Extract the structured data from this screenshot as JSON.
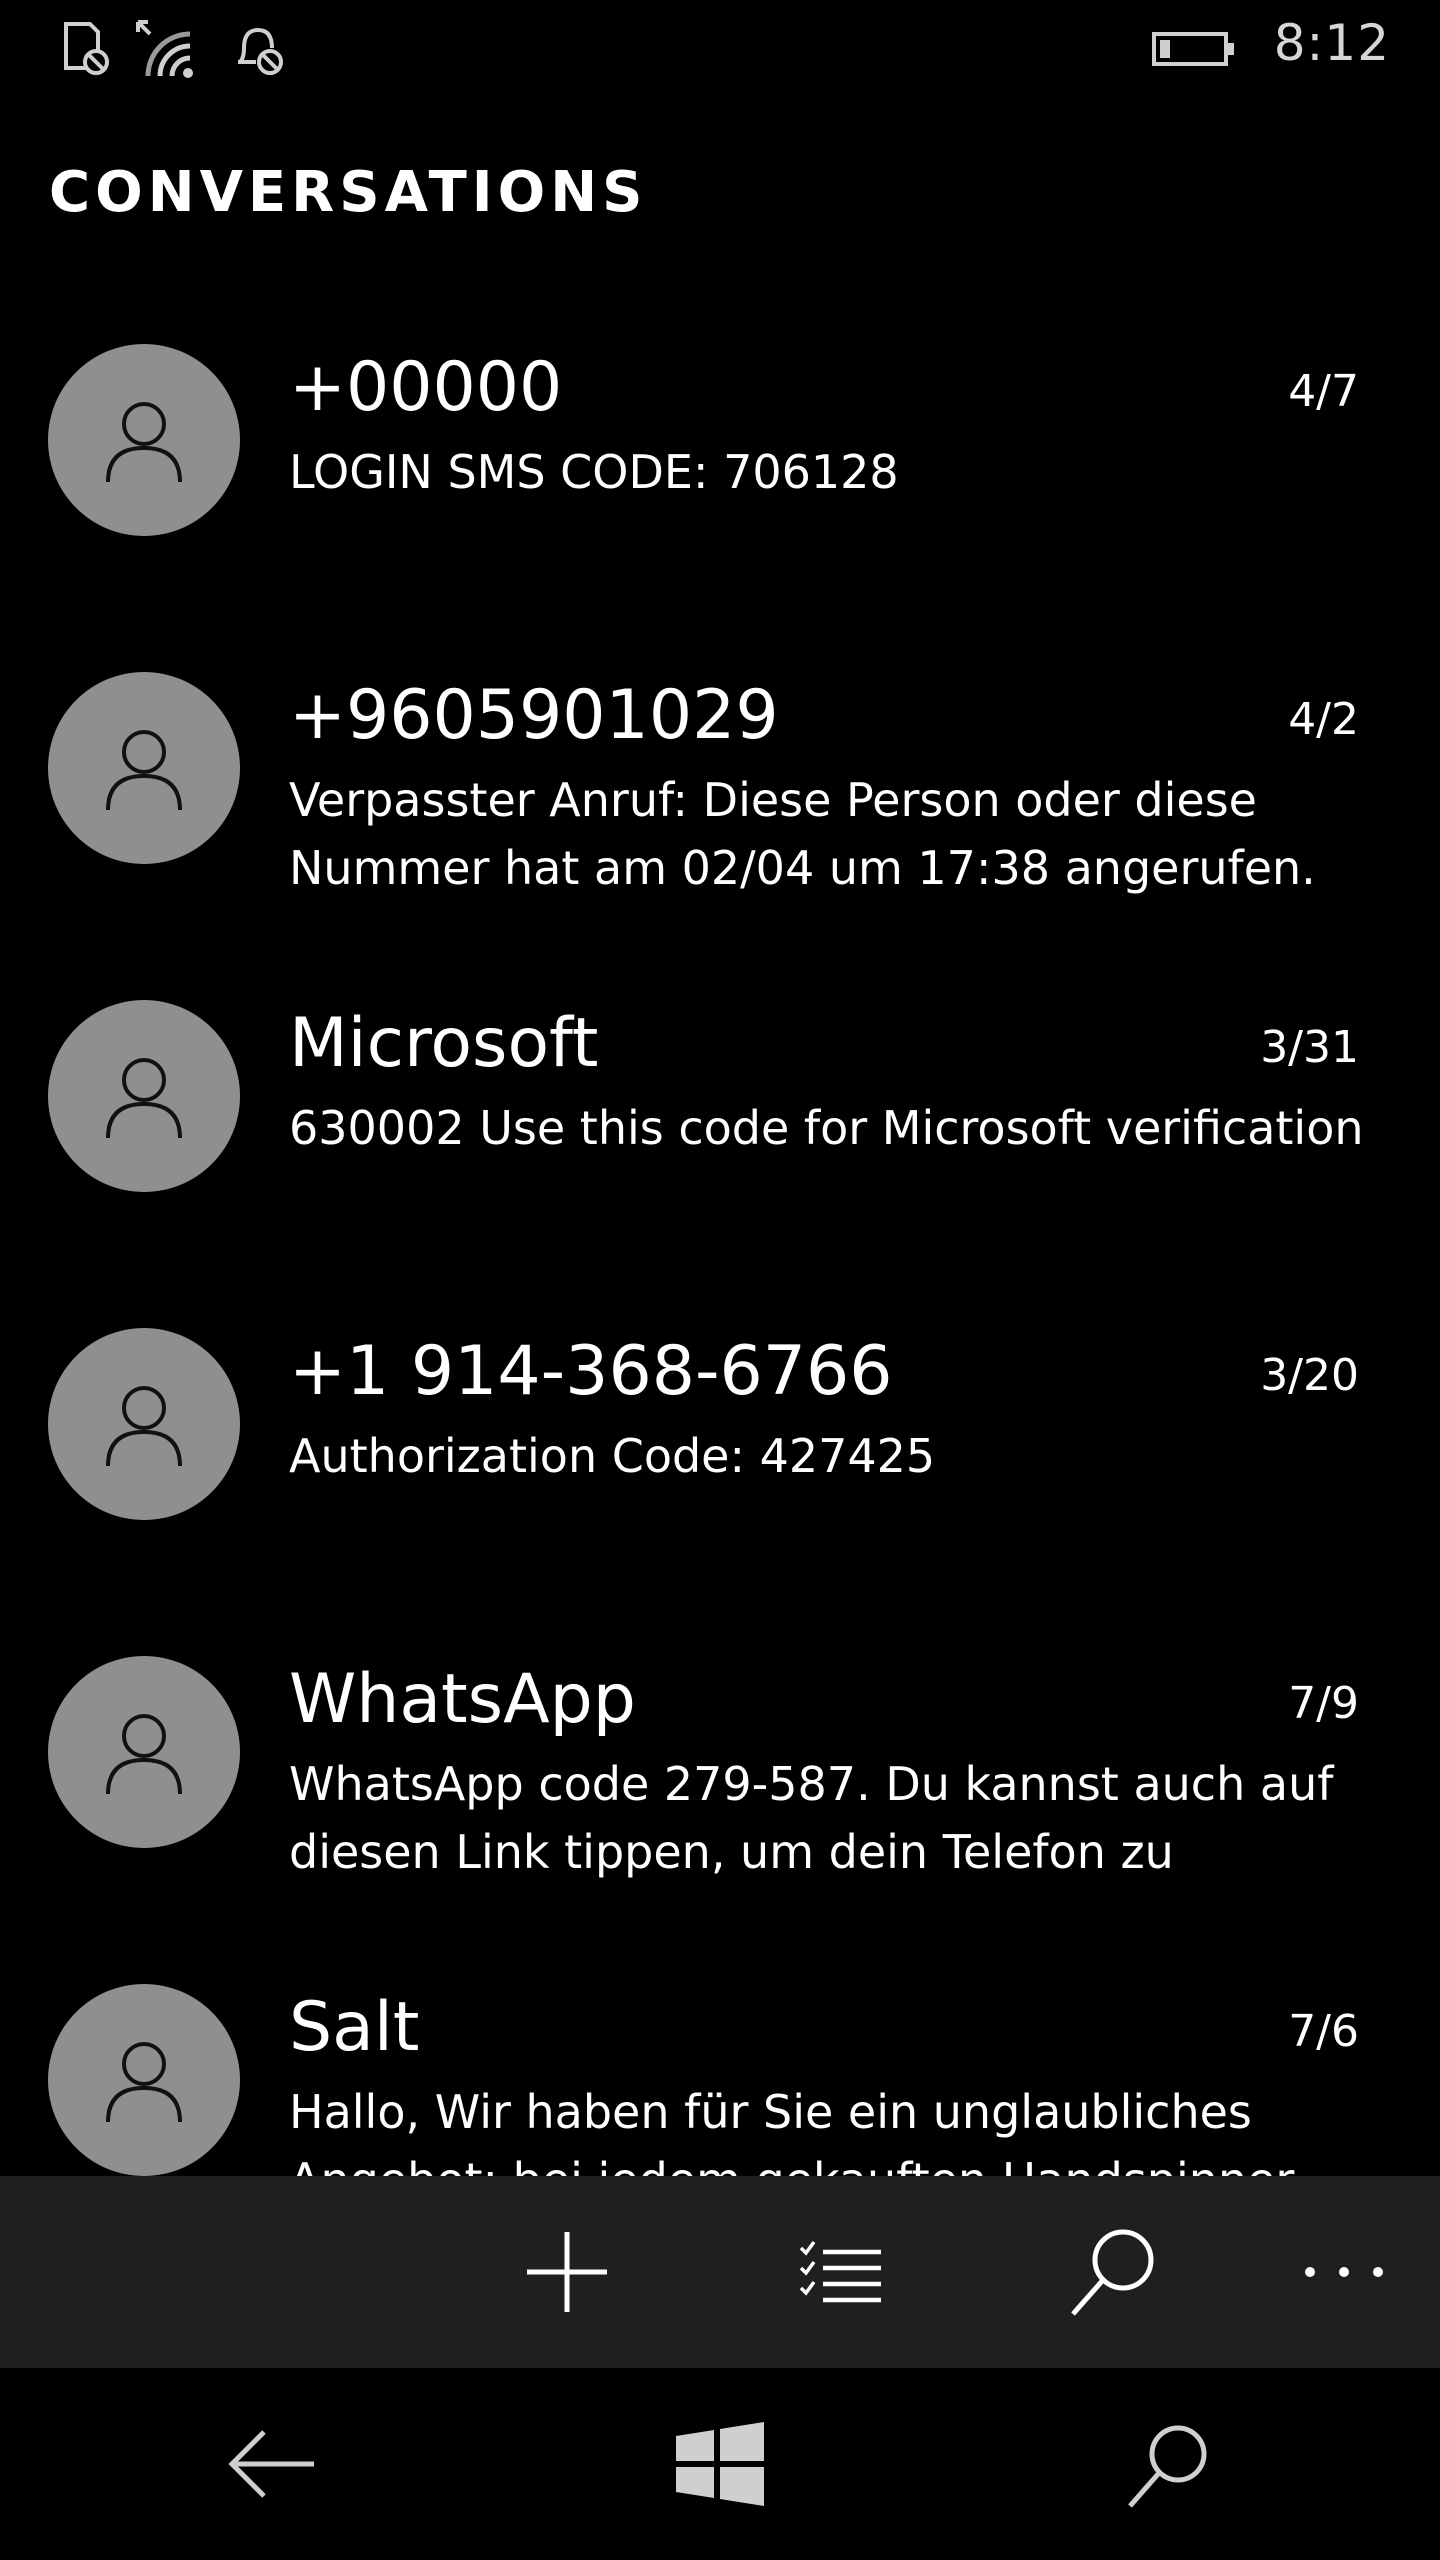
{
  "status_bar": {
    "time": "8:12",
    "icons": [
      "no-sim-icon",
      "signal-icon",
      "no-notifications-icon",
      "battery-icon"
    ]
  },
  "header": {
    "title": "CONVERSATIONS"
  },
  "conversations": [
    {
      "name": "+00000",
      "date": "4/7",
      "preview": "LOGIN SMS CODE: 706128",
      "icon": "person-icon"
    },
    {
      "name": "+9605901029",
      "date": "4/2",
      "preview": "Verpasster Anruf: Diese Person oder diese Nummer hat am 02/04 um 17:38 angerufen.",
      "icon": "person-icon"
    },
    {
      "name": "Microsoft",
      "date": "3/31",
      "preview": "630002 Use this code for Microsoft verification",
      "icon": "person-icon"
    },
    {
      "name": "+1 914-368-6766",
      "date": "3/20",
      "preview": "Authorization Code: 427425",
      "icon": "person-icon"
    },
    {
      "name": "WhatsApp",
      "date": "7/9",
      "preview": "WhatsApp code 279-587.  Du kannst auch auf diesen Link tippen, um dein Telefon zu",
      "icon": "person-icon"
    },
    {
      "name": "Salt",
      "date": "7/6",
      "preview": "Hallo, Wir haben für Sie ein unglaubliches Angebot: bei jedem gekauften Handspinner für",
      "icon": "person-icon"
    }
  ],
  "app_bar": {
    "buttons": [
      "add-icon",
      "select-icon",
      "search-icon",
      "more-icon"
    ]
  },
  "nav_bar": {
    "buttons": [
      "back-icon",
      "windows-icon",
      "search-icon"
    ]
  }
}
